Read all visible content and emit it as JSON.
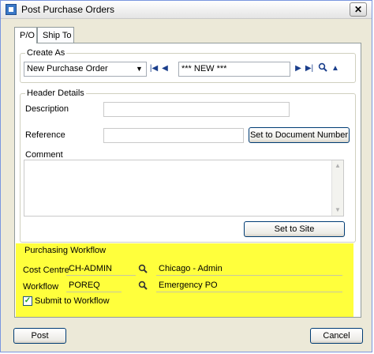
{
  "window": {
    "title": "Post Purchase Orders",
    "close": "✕"
  },
  "tabs": [
    {
      "label": "P/O"
    },
    {
      "label": "Ship To"
    }
  ],
  "create_as": {
    "group_label": "Create As",
    "combo_value": "New Purchase Order",
    "combo_arrow": "▼",
    "record_value": "*** NEW ***",
    "nav": {
      "first": "|◀",
      "prev": "◀",
      "next": "▶",
      "last": "▶|",
      "search": "search-icon",
      "up": "▲"
    }
  },
  "header": {
    "group_label": "Header Details",
    "description_label": "Description",
    "description_value": "",
    "reference_label": "Reference",
    "reference_value": "",
    "set_doc_button": "Set to Document Number",
    "comment_label": "Comment",
    "comment_value": "",
    "set_site_button": "Set to Site"
  },
  "workflow": {
    "group_label": "Purchasing Workflow",
    "cost_centre_label": "Cost Centre",
    "cost_centre_code": "CH-ADMIN",
    "cost_centre_name": "Chicago - Admin",
    "workflow_label": "Workflow",
    "workflow_code": "POREQ",
    "workflow_name": "Emergency PO",
    "submit_label": "Submit to Workflow",
    "submit_checked": "✓",
    "highlight_color": "#ffff3c"
  },
  "footer": {
    "post_button": "Post",
    "cancel_button": "Cancel"
  }
}
